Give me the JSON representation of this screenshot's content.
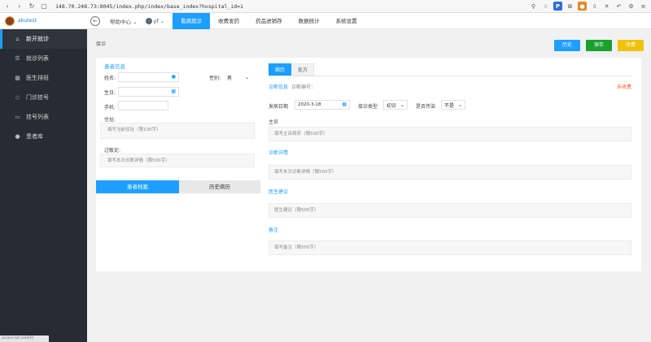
{
  "browser": {
    "url": "148.70.248.73:8045/index.php/index/base_index?hospital_id=1"
  },
  "sidebar": {
    "user_name": "abutest",
    "items": [
      {
        "label": "新开就诊",
        "icon": "home-icon"
      },
      {
        "label": "就诊列表",
        "icon": "list-icon"
      },
      {
        "label": "医生排班",
        "icon": "calendar-icon"
      },
      {
        "label": "门诊挂号",
        "icon": "tag-icon"
      },
      {
        "label": "挂号列表",
        "icon": "card-icon"
      },
      {
        "label": "患者库",
        "icon": "user-icon"
      }
    ]
  },
  "topnav": {
    "help": "帮助中心",
    "user": "yf",
    "tabs": [
      "看病就诊",
      "收费发药",
      "药品进销存",
      "数据统计",
      "系统设置"
    ]
  },
  "content": {
    "breadcrumb": "接诊",
    "buttons": {
      "history": "历史",
      "save": "保存",
      "charge": "收费"
    }
  },
  "patient": {
    "title": "患者信息",
    "name_label": "姓名:",
    "gender_label": "性别:",
    "gender_value": "男",
    "birthday_label": "生日:",
    "phone_label": "手机:",
    "address_label": "住址:",
    "address_placeholder": "填写当前住址（限100字）",
    "history_label": "过敏史:",
    "history_placeholder": "填写本次诊断详情（限500字）",
    "btn_archive": "患者档案",
    "btn_history": "历史病历"
  },
  "record": {
    "tabs": [
      "病历",
      "处方"
    ],
    "diag_info": "诊断信息",
    "diag_no": "诊断编号：",
    "unpaid": "未收费",
    "visit_date_label": "发病日期",
    "visit_date": "2020-3-18",
    "visit_type_label": "接诊类型",
    "visit_type": "初诊",
    "infectious_label": "是否传染",
    "infectious": "不是",
    "chief_label": "主诉",
    "chief_placeholder": "填写主诉病状（限500字）",
    "detail_label": "诊断详情",
    "detail_placeholder": "填写本次诊断详情（限500字）",
    "advice_label": "医生建议",
    "advice_placeholder": "医生建议（限500字）",
    "remark_label": "备注",
    "remark_placeholder": "填写备注（限500字）"
  },
  "status": {
    "bottom_text": "javascript:void(0)"
  }
}
